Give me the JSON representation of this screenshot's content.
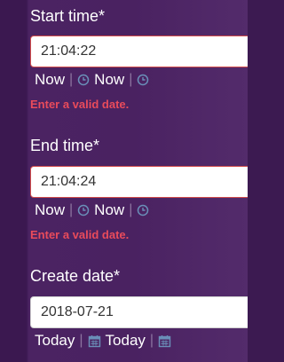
{
  "fields": [
    {
      "label": "Start time*",
      "value": "21:04:22",
      "shortcuts": [
        "Now",
        "Now"
      ],
      "error": "Enter a valid date."
    },
    {
      "label": "End time*",
      "value": "21:04:24",
      "shortcuts": [
        "Now",
        "Now"
      ],
      "error": "Enter a valid date."
    },
    {
      "label": "Create date*",
      "value": "2018-07-21",
      "shortcuts": [
        "Today",
        "Today"
      ]
    }
  ],
  "separator": "|",
  "colors": {
    "background": "#4a2261",
    "error_text": "#e94b5b",
    "icon": "#6a8fb8",
    "invalid_border": "#d14b4b"
  },
  "icons": {
    "time": "clock-icon",
    "date": "calendar-icon"
  }
}
